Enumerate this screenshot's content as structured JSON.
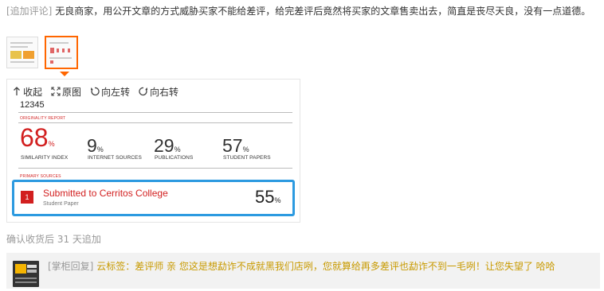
{
  "review": {
    "tag": "[追加评论]",
    "text": " 无良商家，用公开文章的方式威胁买家不能给差评，给完差评后竟然将买家的文章售卖出去，简直是丧尽天良，没有一点道德。"
  },
  "viewer": {
    "toolbar": {
      "collapse": "收起",
      "original": "原图",
      "rotate_left": "向左转",
      "rotate_right": "向右转"
    },
    "document": {
      "id": "12345",
      "originality_header": "ORIGINALITY REPORT",
      "stats": [
        {
          "value": "68",
          "unit": "%",
          "label": "SIMILARITY INDEX"
        },
        {
          "value": "9",
          "unit": "%",
          "label": "INTERNET SOURCES"
        },
        {
          "value": "29",
          "unit": "%",
          "label": "PUBLICATIONS"
        },
        {
          "value": "57",
          "unit": "%",
          "label": "STUDENT PAPERS"
        }
      ],
      "primary_sources_header": "PRIMARY SOURCES",
      "source": {
        "rank": "1",
        "name": "Submitted to Cerritos College",
        "type": "Student Paper",
        "value": "55",
        "unit": "%"
      }
    }
  },
  "added_note": "确认收货后 31 天追加",
  "reply": {
    "tag": "[掌柜回复]",
    "text": " 云标签：差评师 亲 您这是想勐诈不成就黑我们店咧，您就算给再多差评也勐诈不到一毛咧！让您失望了 哈哈"
  },
  "colors": {
    "accent_red": "#d21f1f",
    "highlight_blue": "#2c9ae0",
    "thumb_selected": "#ff6600",
    "reply_text": "#c89a00"
  },
  "icons": [
    "collapse-arrow-icon",
    "fullscreen-icon",
    "rotate-left-icon",
    "rotate-right-icon"
  ]
}
